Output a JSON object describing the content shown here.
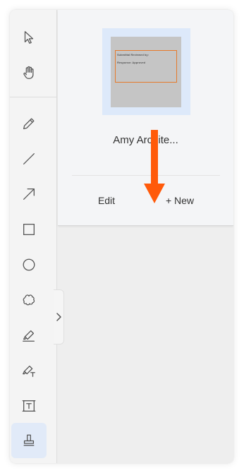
{
  "toolbar": {
    "tools": [
      {
        "name": "select-tool",
        "icon": "cursor-arrow-icon"
      },
      {
        "name": "pan-tool",
        "icon": "hand-icon"
      },
      {
        "name": "pen-tool",
        "icon": "pencil-icon"
      },
      {
        "name": "line-tool",
        "icon": "line-icon"
      },
      {
        "name": "arrow-tool",
        "icon": "diagonal-arrow-icon"
      },
      {
        "name": "rectangle-tool",
        "icon": "square-icon"
      },
      {
        "name": "ellipse-tool",
        "icon": "circle-icon"
      },
      {
        "name": "cloud-tool",
        "icon": "cloud-icon"
      },
      {
        "name": "highlighter-tool",
        "icon": "highlighter-icon"
      },
      {
        "name": "text-highlighter-tool",
        "icon": "text-highlighter-icon"
      },
      {
        "name": "textbox-tool",
        "icon": "text-box-icon"
      },
      {
        "name": "stamp-tool",
        "icon": "stamp-icon",
        "active": true
      }
    ],
    "collapse_icon": "chevron-right-icon"
  },
  "stamp_panel": {
    "stamp_preview": {
      "line1": "Submittal Reviewed by:",
      "line2": "Response: Approved",
      "border_color": "#e67a2c"
    },
    "stamp_name": "Amy Archite...",
    "edit_label": "Edit",
    "new_label": "+ New"
  },
  "callout_arrow": {
    "color": "#ff5a0a",
    "icon": "down-arrow-icon"
  },
  "colors": {
    "active_tool_bg": "#e1eaf8",
    "thumb_selected_bg": "#dde9fa"
  }
}
